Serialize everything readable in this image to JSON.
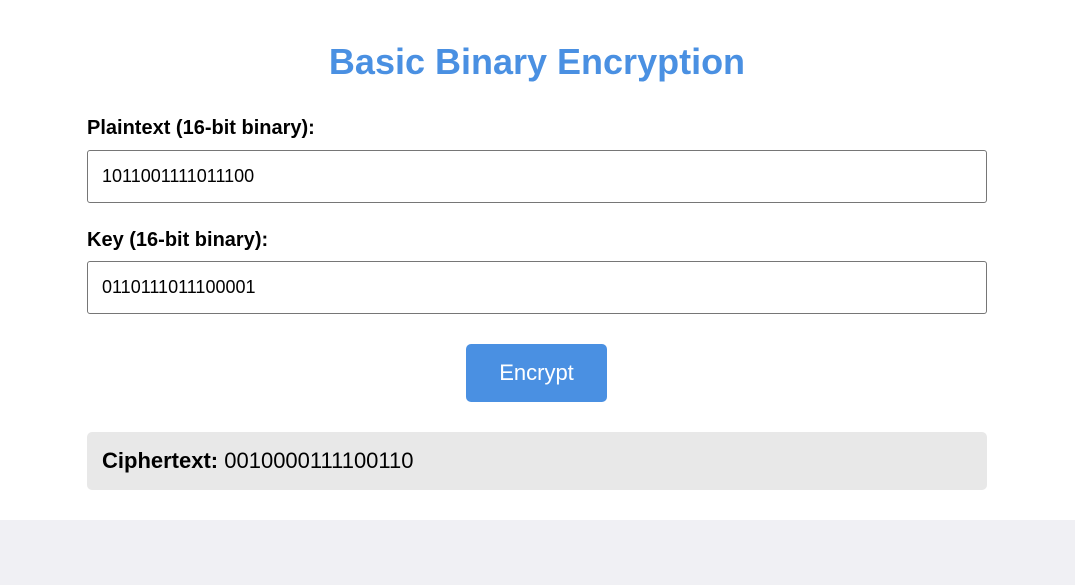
{
  "title": "Basic Binary Encryption",
  "plaintext": {
    "label": "Plaintext (16-bit binary):",
    "value": "1011001111011100"
  },
  "key": {
    "label": "Key (16-bit binary):",
    "value": "0110111011100001"
  },
  "encrypt_button": "Encrypt",
  "result": {
    "label": "Ciphertext:",
    "value": "0010000111100110"
  },
  "colors": {
    "accent": "#4a90e2",
    "result_bg": "#e8e8e8",
    "footer_bg": "#f0f0f4"
  }
}
